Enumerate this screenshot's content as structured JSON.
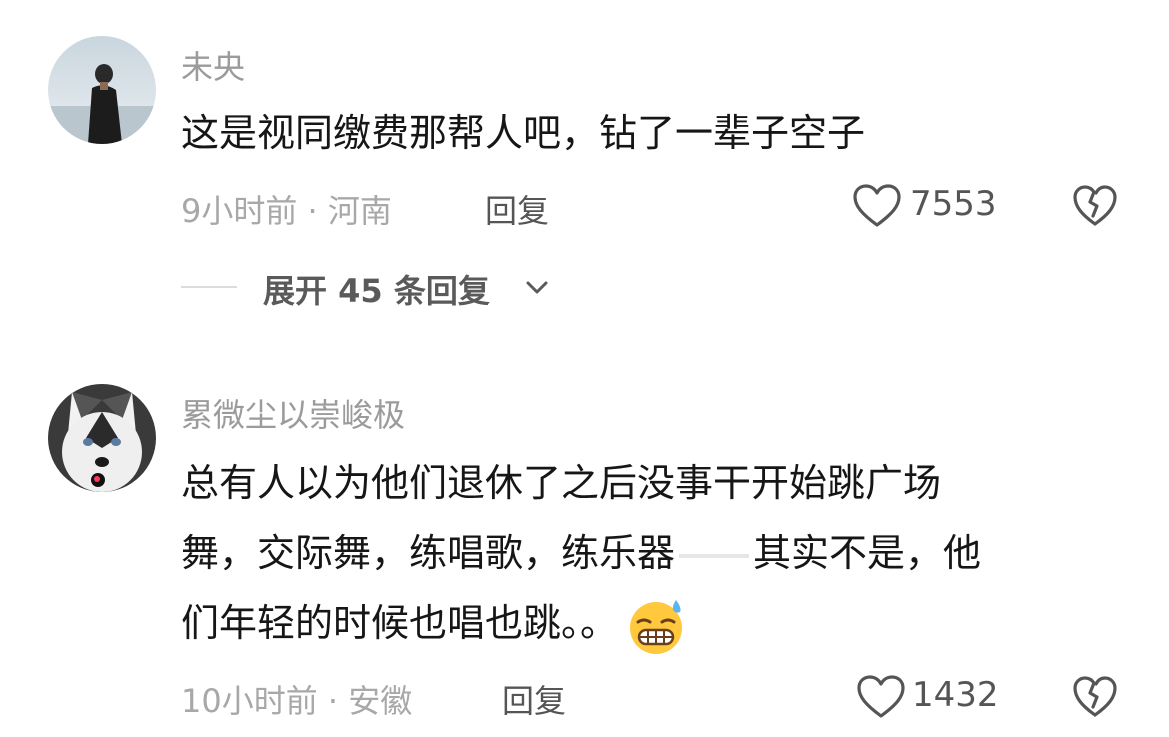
{
  "comments": [
    {
      "username": "未央",
      "text": "这是视同缴费那帮人吧，钻了一辈子空子",
      "meta": "9小时前 · 河南",
      "reply_label": "回复",
      "likes": "7553",
      "expand_label": "展开 45 条回复"
    },
    {
      "username": "累微尘以崇峻极",
      "text_line1": "总有人以为他们退休了之后没事干开始跳广场",
      "text_line2a": "舞，交际舞，练唱歌，练乐器",
      "text_line2b": "其实不是，他",
      "text_line3": "们年轻的时候也唱也跳。。",
      "emoji": "grinning-sweat-emoji",
      "meta": "10小时前 · 安徽",
      "reply_label": "回复",
      "likes": "1432"
    }
  ],
  "colors": {
    "text": "#161616",
    "muted": "#9b9b9b",
    "icon": "#555555"
  }
}
